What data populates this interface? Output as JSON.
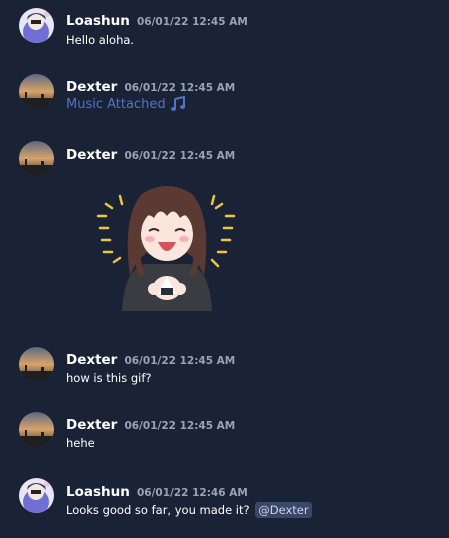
{
  "colors": {
    "background": "#1a2336",
    "link": "#4f74c6",
    "timestamp": "#9aa3b2",
    "mention_bg": "#3a4766"
  },
  "messages": [
    {
      "author": "Loashun",
      "timestamp": "06/01/22 12:45 AM",
      "text": "Hello aloha."
    },
    {
      "author": "Dexter",
      "timestamp": "06/01/22 12:45 AM",
      "attachment_label": "Music Attached",
      "attachment_icon": "music-note-icon"
    },
    {
      "author": "Dexter",
      "timestamp": "06/01/22 12:45 AM",
      "attachment_icon": "anime-girl-gif"
    },
    {
      "author": "Dexter",
      "timestamp": "06/01/22 12:45 AM",
      "text": "how is this gif?"
    },
    {
      "author": "Dexter",
      "timestamp": "06/01/22 12:45 AM",
      "text": "hehe"
    },
    {
      "author": "Loashun",
      "timestamp": "06/01/22 12:46 AM",
      "text": "Looks good so far, you made it?",
      "mention": "@Dexter"
    }
  ]
}
